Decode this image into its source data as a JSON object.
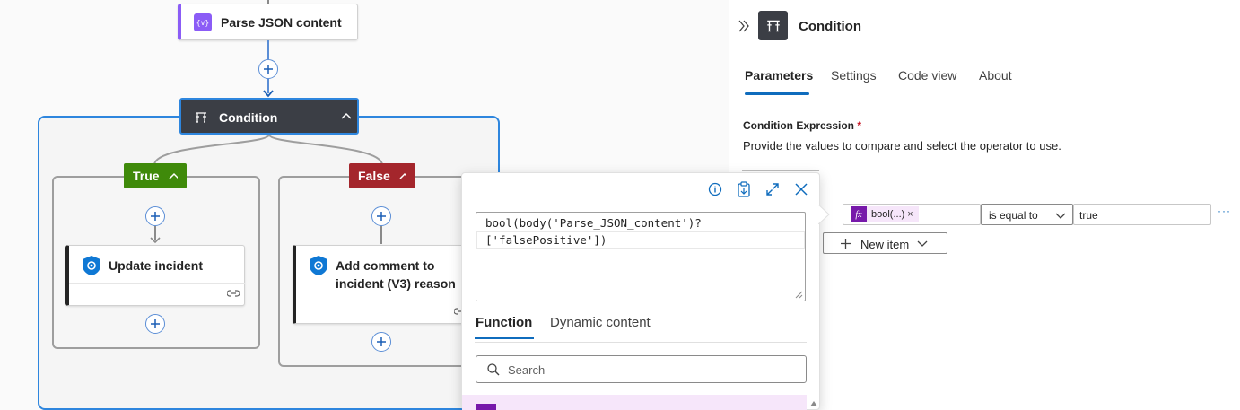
{
  "designer": {
    "parse_json": {
      "label": "Parse JSON content"
    },
    "condition": {
      "label": "Condition"
    },
    "true_branch": {
      "label": "True",
      "action": "Update incident"
    },
    "false_branch": {
      "label": "False",
      "action_line1": "Add comment to",
      "action_line2": "incident (V3) reason"
    }
  },
  "panel": {
    "title": "Condition",
    "tabs": [
      "Parameters",
      "Settings",
      "Code view",
      "About"
    ],
    "active_tab": "Parameters",
    "condition_expression_label": "Condition Expression",
    "required_mark": "*",
    "description": "Provide the values to compare and select the operator to use.",
    "row": {
      "token_label": "bool(...)",
      "token_remove": "×",
      "operator": "is equal to",
      "value": "true",
      "more": "···"
    },
    "new_item_label": "New item"
  },
  "popup": {
    "expression_line1": "bool(body('Parse_JSON_content')?",
    "expression_line2": "['falsePositive'])",
    "tabs": [
      "Function",
      "Dynamic content"
    ],
    "active_tab": "Function",
    "search_placeholder": "Search"
  },
  "colors": {
    "accent": "#0f6cbd",
    "true_green": "#3f8a0a",
    "false_red": "#a4262c",
    "condition_header": "#3b3e45",
    "parse_json_purple": "#8b5cf6",
    "function_token": "#7719aa"
  }
}
